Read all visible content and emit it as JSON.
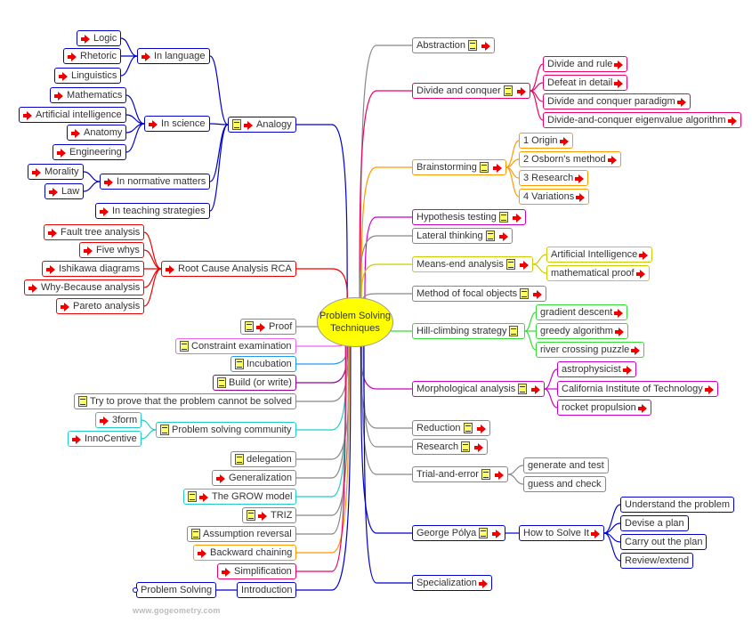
{
  "title": "Problem Solving Techniques",
  "central_node": {
    "label_line1": "Problem Solving",
    "label_line2": "Techniques",
    "color": "#ffff00"
  },
  "watermark": "www.gogeometry.com",
  "icons": {
    "note": "note-icon",
    "link": "arrow-right-icon"
  },
  "colors": {
    "blue": "#0000cc",
    "red": "#ee0000",
    "gray": "#888888",
    "pink": "#ee66ee",
    "skyblue": "#2299ee",
    "purple": "#990099",
    "cyan": "#22cccc",
    "orange": "#ff9900",
    "crimson": "#ee0066",
    "magenta": "#cc00cc",
    "olive": "#cccc00",
    "green": "#33dd33"
  },
  "left_branches": [
    {
      "label": "Analogy",
      "note": true,
      "link": true,
      "color": "blue",
      "children": [
        {
          "label": "In language",
          "link": true,
          "children": [
            {
              "label": "Logic",
              "link": true
            },
            {
              "label": "Rhetoric",
              "link": true
            },
            {
              "label": "Linguistics",
              "link": true
            }
          ]
        },
        {
          "label": "In science",
          "link": true,
          "children": [
            {
              "label": "Mathematics",
              "link": true
            },
            {
              "label": "Artificial intelligence",
              "link": true
            },
            {
              "label": "Anatomy",
              "link": true
            },
            {
              "label": "Engineering",
              "link": true
            }
          ]
        },
        {
          "label": "In normative matters",
          "link": true,
          "children": [
            {
              "label": "Morality",
              "link": true
            },
            {
              "label": "Law",
              "link": true
            }
          ]
        },
        {
          "label": "In teaching strategies",
          "link": true
        }
      ]
    },
    {
      "label": "Root Cause Analysis RCA",
      "link": true,
      "color": "red",
      "children": [
        {
          "label": "Fault tree analysis",
          "link": true
        },
        {
          "label": "Five whys",
          "link": true
        },
        {
          "label": "Ishikawa diagrams",
          "link": true
        },
        {
          "label": "Why-Because analysis",
          "link": true
        },
        {
          "label": "Pareto analysis",
          "link": true
        }
      ]
    },
    {
      "label": "Proof",
      "note": true,
      "link": true,
      "color": "gray"
    },
    {
      "label": "Constraint examination",
      "note": true,
      "color": "pink"
    },
    {
      "label": "Incubation",
      "note": true,
      "color": "skyblue"
    },
    {
      "label": "Build (or write)",
      "note": true,
      "color": "purple"
    },
    {
      "label": "Try to prove that the problem cannot be solved",
      "note": true,
      "color": "gray"
    },
    {
      "label": "Problem solving community",
      "note": true,
      "color": "cyan",
      "children": [
        {
          "label": "3form",
          "link": true
        },
        {
          "label": "InnoCentive",
          "link": true
        }
      ]
    },
    {
      "label": "delegation",
      "note": true,
      "color": "gray"
    },
    {
      "label": "Generalization",
      "link": true,
      "color": "gray"
    },
    {
      "label": "The GROW model",
      "note": true,
      "link": true,
      "color": "cyan"
    },
    {
      "label": "TRIZ",
      "note": true,
      "link": true,
      "color": "gray"
    },
    {
      "label": "Assumption reversal",
      "note": true,
      "color": "gray"
    },
    {
      "label": "Backward chaining",
      "link": true,
      "color": "orange"
    },
    {
      "label": "Simplification",
      "link": true,
      "color": "crimson"
    },
    {
      "label": "Introduction",
      "color": "blue",
      "children": [
        {
          "label": "Problem Solving"
        }
      ]
    }
  ],
  "right_branches": [
    {
      "label": "Abstraction",
      "note": true,
      "link": true,
      "color": "gray"
    },
    {
      "label": "Divide and conquer",
      "note": true,
      "link": true,
      "color": "crimson",
      "children": [
        {
          "label": "Divide and rule",
          "link": true
        },
        {
          "label": "Defeat in detail",
          "link": true
        },
        {
          "label": "Divide and conquer paradigm",
          "link": true
        },
        {
          "label": "Divide-and-conquer eigenvalue algorithm",
          "link": true
        }
      ]
    },
    {
      "label": "Brainstorming",
      "note": true,
      "link": true,
      "color": "orange",
      "children": [
        {
          "label": "1 Origin",
          "link": true
        },
        {
          "label": "2 Osborn's method",
          "link": true
        },
        {
          "label": "3 Research",
          "link": true
        },
        {
          "label": "4 Variations",
          "link": true
        }
      ]
    },
    {
      "label": "Hypothesis testing",
      "note": true,
      "link": true,
      "color": "magenta"
    },
    {
      "label": "Lateral thinking",
      "note": true,
      "link": true,
      "color": "gray"
    },
    {
      "label": "Means-end analysis",
      "note": true,
      "link": true,
      "color": "olive",
      "children": [
        {
          "label": "Artificial Intelligence",
          "link": true
        },
        {
          "label": "mathematical proof",
          "link": true
        }
      ]
    },
    {
      "label": "Method of focal objects",
      "note": true,
      "link": true,
      "color": "gray"
    },
    {
      "label": "Hill-climbing strategy",
      "note": true,
      "color": "green",
      "children": [
        {
          "label": "gradient descent",
          "link": true
        },
        {
          "label": "greedy algorithm",
          "link": true
        },
        {
          "label": "river crossing puzzle",
          "link": true
        }
      ]
    },
    {
      "label": "Morphological analysis",
      "note": true,
      "link": true,
      "color": "magenta",
      "children": [
        {
          "label": "astrophysicist",
          "link": true
        },
        {
          "label": "California Institute of Technology",
          "link": true
        },
        {
          "label": "rocket propulsion",
          "link": true
        }
      ]
    },
    {
      "label": "Reduction",
      "note": true,
      "link": true,
      "color": "gray"
    },
    {
      "label": "Research",
      "note": true,
      "link": true,
      "color": "gray"
    },
    {
      "label": "Trial-and-error",
      "note": true,
      "link": true,
      "color": "gray",
      "children": [
        {
          "label": "generate and test"
        },
        {
          "label": "guess and check"
        }
      ]
    },
    {
      "label": "George Pólya",
      "note": true,
      "link": true,
      "color": "blue",
      "children": [
        {
          "label": "How to Solve It",
          "link": true,
          "children": [
            {
              "label": "Understand the problem"
            },
            {
              "label": "Devise a plan"
            },
            {
              "label": "Carry out the plan"
            },
            {
              "label": "Review/extend"
            }
          ]
        }
      ]
    },
    {
      "label": "Specialization",
      "link": true,
      "color": "blue"
    }
  ]
}
